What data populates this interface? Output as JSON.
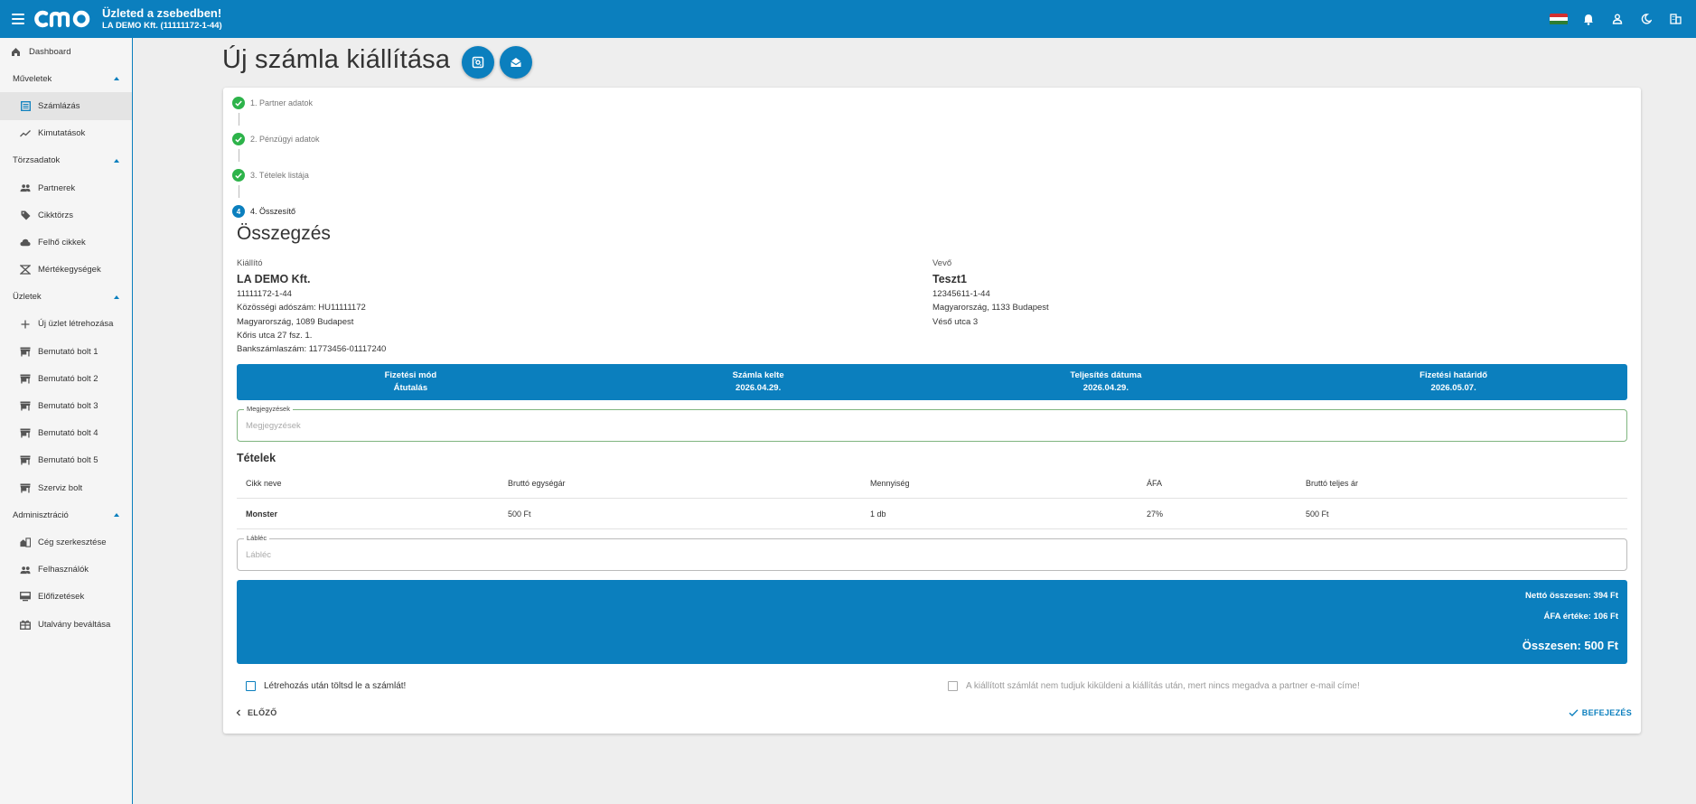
{
  "header": {
    "logo_text": "cmo",
    "title": "Üzleted a zsebedben!",
    "subtitle": "LA DEMO Kft. (11111172-1-44)",
    "icons": [
      "hungarian-flag-icon",
      "bell-icon",
      "user-icon",
      "moon-icon",
      "building-icon"
    ]
  },
  "sidebar": {
    "dashboard": "Dashboard",
    "groups": [
      {
        "label": "Műveletek",
        "items": [
          {
            "label": "Számlázás",
            "icon": "list-icon",
            "active": true
          },
          {
            "label": "Kimutatások",
            "icon": "chart-icon"
          }
        ]
      },
      {
        "label": "Törzsadatok",
        "items": [
          {
            "label": "Partnerek",
            "icon": "people-icon"
          },
          {
            "label": "Cikktörzs",
            "icon": "tag-icon"
          },
          {
            "label": "Felhő cikkek",
            "icon": "cloud-icon"
          },
          {
            "label": "Mértékegységek",
            "icon": "scale-icon"
          }
        ]
      },
      {
        "label": "Üzletek",
        "items": [
          {
            "label": "Új üzlet létrehozása",
            "icon": "plus-icon"
          },
          {
            "label": "Bemutató bolt 1",
            "icon": "store-icon"
          },
          {
            "label": "Bemutató bolt 2",
            "icon": "store-icon"
          },
          {
            "label": "Bemutató bolt 3",
            "icon": "store-icon"
          },
          {
            "label": "Bemutató bolt 4",
            "icon": "store-icon"
          },
          {
            "label": "Bemutató bolt 5",
            "icon": "store-icon"
          },
          {
            "label": "Szerviz bolt",
            "icon": "store-icon"
          }
        ]
      },
      {
        "label": "Adminisztráció",
        "items": [
          {
            "label": "Cég szerkesztése",
            "icon": "company-icon"
          },
          {
            "label": "Felhasználók",
            "icon": "people-icon"
          },
          {
            "label": "Előfizetések",
            "icon": "monitor-icon"
          },
          {
            "label": "Utalvány beváltása",
            "icon": "gift-icon"
          }
        ]
      }
    ]
  },
  "page": {
    "title": "Új számla kiállítása"
  },
  "steps": [
    "1. Partner adatok",
    "2. Pénzügyi adatok",
    "3. Tételek listája",
    "4. Összesítő"
  ],
  "current_step_number": "4",
  "summary": {
    "title": "Összegzés",
    "issuer": {
      "label": "Kiállító",
      "name": "LA DEMO Kft.",
      "tax_number": "11111172-1-44",
      "eu_tax": "Közösségi adószám: HU11111172",
      "address1": "Magyarország, 1089 Budapest",
      "address2": "Kőris utca 27 fsz. 1.",
      "bank": "Bankszámlaszám: 11773456-01117240"
    },
    "buyer": {
      "label": "Vevő",
      "name": "Teszt1",
      "tax_number": "12345611-1-44",
      "address1": "Magyarország, 1133 Budapest",
      "address2": "Véső utca 3"
    },
    "info": [
      {
        "label": "Fizetési mód",
        "value": "Átutalás"
      },
      {
        "label": "Számla kelte",
        "value": "2026.04.29."
      },
      {
        "label": "Teljesítés dátuma",
        "value": "2026.04.29."
      },
      {
        "label": "Fizetési határidő",
        "value": "2026.05.07."
      }
    ],
    "notes": {
      "label": "Megjegyzések",
      "placeholder": "Megjegyzések",
      "value": ""
    },
    "items_title": "Tételek",
    "table": {
      "columns": [
        "Cikk neve",
        "Bruttó egységár",
        "Mennyiség",
        "ÁFA",
        "Bruttó teljes ár"
      ],
      "rows": [
        [
          "Monster",
          "500 Ft",
          "1 db",
          "27%",
          "500 Ft"
        ]
      ]
    },
    "footer_field": {
      "label": "Lábléc",
      "placeholder": "Lábléc",
      "value": ""
    },
    "totals": {
      "net": "Nettó összesen: 394 Ft",
      "vat": "ÁFA értéke: 106 Ft",
      "total": "Összesen: 500 Ft"
    },
    "download_checkbox": "Létrehozás után töltsd le a számlát!",
    "email_checkbox": "A kiállított számlát nem tudjuk kiküldeni a kiállítás után, mert nincs megadva a partner e-mail címe!",
    "prev_button": "ELŐZŐ",
    "finish_button": "BEFEJEZÉS"
  },
  "colors": {
    "primary": "#0b7fbe",
    "success": "#2db34a",
    "background": "#eeeeee"
  }
}
